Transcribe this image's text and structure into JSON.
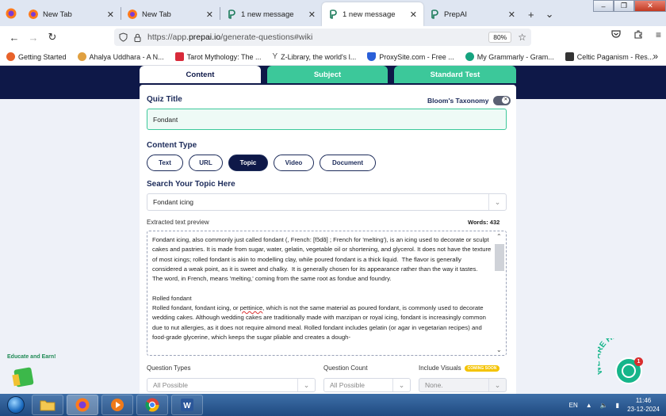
{
  "browser": {
    "tabs": [
      {
        "label": "New Tab",
        "active": false
      },
      {
        "label": "New Tab",
        "active": false
      },
      {
        "label": "1 new message",
        "active": false
      },
      {
        "label": "1 new message",
        "active": true
      },
      {
        "label": "PrepAI",
        "active": false
      }
    ],
    "close_glyph": "✕",
    "new_tab_glyph": "+",
    "list_tabs_glyph": "⌄",
    "window": {
      "minimize": "–",
      "maximize": "❐",
      "close": "✕"
    },
    "url": {
      "prefix": "https://app.",
      "host": "prepai.io",
      "path": "/generate-questions#wiki"
    },
    "zoom": "80%",
    "bookmarks": [
      {
        "label": "Getting Started",
        "color": "#e8622a"
      },
      {
        "label": "Ahalya Uddhara - A N...",
        "color": "#e0a040"
      },
      {
        "label": "Tarot Mythology: The ...",
        "color": "#d82a3a"
      },
      {
        "label": "Z-Library, the world's l...",
        "color": "#8a8a8a"
      },
      {
        "label": "ProxySite.com - Free ...",
        "color": "#2a5fd8"
      },
      {
        "label": "My Grammarly - Gram...",
        "color": "#15a37f"
      },
      {
        "label": "Celtic Paganism - Res...",
        "color": "#333333"
      }
    ],
    "bookmarks_overflow": "»"
  },
  "app": {
    "tabs": [
      {
        "label": "Content",
        "active": true
      },
      {
        "label": "Subject",
        "active": false
      },
      {
        "label": "Standard Test",
        "active": false
      }
    ],
    "quiz_title_label": "Quiz Title",
    "blooms_label": "Bloom's Taxonomy",
    "quiz_title_value": "Fondant",
    "content_type_label": "Content Type",
    "content_types": [
      {
        "label": "Text",
        "selected": false
      },
      {
        "label": "URL",
        "selected": false
      },
      {
        "label": "Topic",
        "selected": true
      },
      {
        "label": "Video",
        "selected": false
      },
      {
        "label": "Document",
        "selected": false
      }
    ],
    "search_topic_label": "Search Your Topic Here",
    "search_topic_value": "Fondant icing",
    "preview_label": "Extracted text preview",
    "words": "Words: 432",
    "preview_p1_a": "Fondant icing, also commonly just called fondant (, French: [fɔ̃dɑ̃] ; French for 'melting'), is an icing used to decorate or sculpt cakes and pastries. It is made from sugar, water, gelatin, vegetable oil or shortening, and glycerol. It does not have the texture of most icings; rolled fondant is akin to modelling clay, while poured fondant is a thick liquid.  The flavor is generally considered a weak point, as it is sweet and chalky.  It is generally chosen for its appearance rather than the way it tastes.",
    "preview_p1_b": "The word, in French, means 'melting,' coming from the same root as fondue and foundry.",
    "preview_h2": "Rolled fondant",
    "preview_p2_a": "Rolled fondant, fondant icing, or ",
    "preview_p2_mis": "pettinice",
    "preview_p2_b": ", which is not the same material as poured fondant, is commonly used to decorate wedding cakes. Although wedding cakes are traditionally made with marzipan or royal icing, fondant is increasingly common due to nut allergies, as it does not require almond meal. Rolled fondant includes gelatin (or agar in vegetarian recipes) and food-grade glycerine, which keeps the sugar pliable and creates a dough-",
    "question_types_label": "Question Types",
    "question_types_value": "All Possible",
    "question_count_label": "Question Count",
    "question_count_value": "All Possible",
    "include_visuals_label": "Include Visuals",
    "coming_soon": "COMING SOON",
    "include_visuals_value": "None.",
    "educate_earn": "Educate and Earn!",
    "we_are_here": "WE ARE HERE!",
    "chat_badge": "1",
    "accent_color": "#3cc89a",
    "navy_color": "#0e1848"
  },
  "taskbar": {
    "lang": "EN",
    "time": "11:46",
    "date": "23-12-2024"
  }
}
